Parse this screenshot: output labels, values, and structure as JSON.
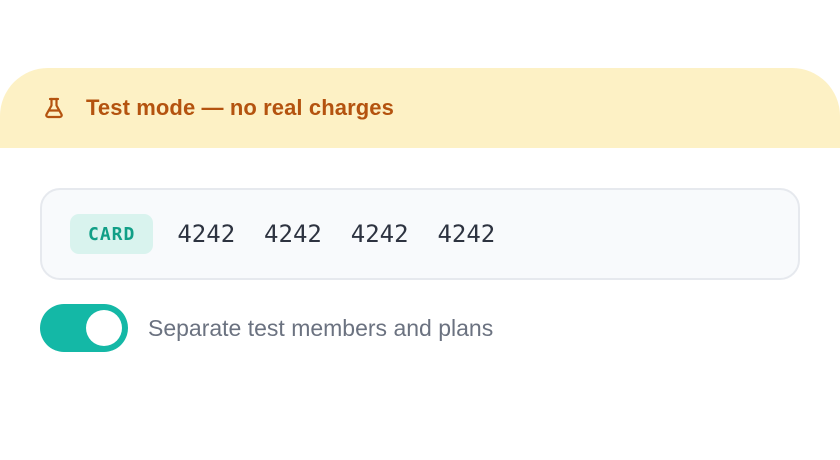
{
  "banner": {
    "icon": "flask-icon",
    "text": "Test mode — no real charges",
    "background": "#fdf1c5",
    "text_color": "#b4530f"
  },
  "card_field": {
    "badge": "CARD",
    "number": "4242  4242  4242  4242",
    "badge_background": "#d9f3ee",
    "badge_color": "#119f87"
  },
  "toggle": {
    "label": "Separate test members and plans",
    "checked": true,
    "color": "#14b8a6"
  }
}
